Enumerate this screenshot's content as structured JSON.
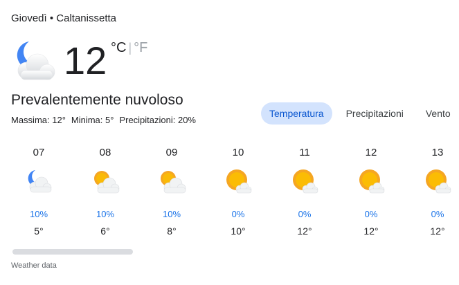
{
  "header": {
    "text": "Giovedì • Caltanissetta"
  },
  "current": {
    "temp": "12",
    "unit_c": "°C",
    "unit_sep": "|",
    "unit_f": "°F",
    "condition": "Prevalentemente nuvoloso",
    "icon": "moon-cloud-icon",
    "max": "Massima: 12°",
    "min": "Minima: 5°",
    "precip": "Precipitazioni: 20%"
  },
  "tabs": [
    {
      "label": "Temperatura",
      "active": true
    },
    {
      "label": "Precipitazioni",
      "active": false
    },
    {
      "label": "Vento",
      "active": false
    }
  ],
  "hours": [
    {
      "time": "07",
      "icon": "moon-cloud-icon",
      "precip": "10%",
      "temp": "5°"
    },
    {
      "time": "08",
      "icon": "sun-cloud-icon",
      "precip": "10%",
      "temp": "6°"
    },
    {
      "time": "09",
      "icon": "sun-cloud-icon",
      "precip": "10%",
      "temp": "8°"
    },
    {
      "time": "10",
      "icon": "sun-small-cloud-icon",
      "precip": "0%",
      "temp": "10°"
    },
    {
      "time": "11",
      "icon": "sun-small-cloud-icon",
      "precip": "0%",
      "temp": "12°"
    },
    {
      "time": "12",
      "icon": "sun-small-cloud-icon",
      "precip": "0%",
      "temp": "12°"
    },
    {
      "time": "13",
      "icon": "sun-small-cloud-icon",
      "precip": "0%",
      "temp": "12°"
    }
  ],
  "footer": {
    "source": "Weather data"
  },
  "colors": {
    "accent": "#1a73e8",
    "active_tab_bg": "#d3e3fd",
    "sun": "#f5a623",
    "moon": "#4285f4"
  }
}
